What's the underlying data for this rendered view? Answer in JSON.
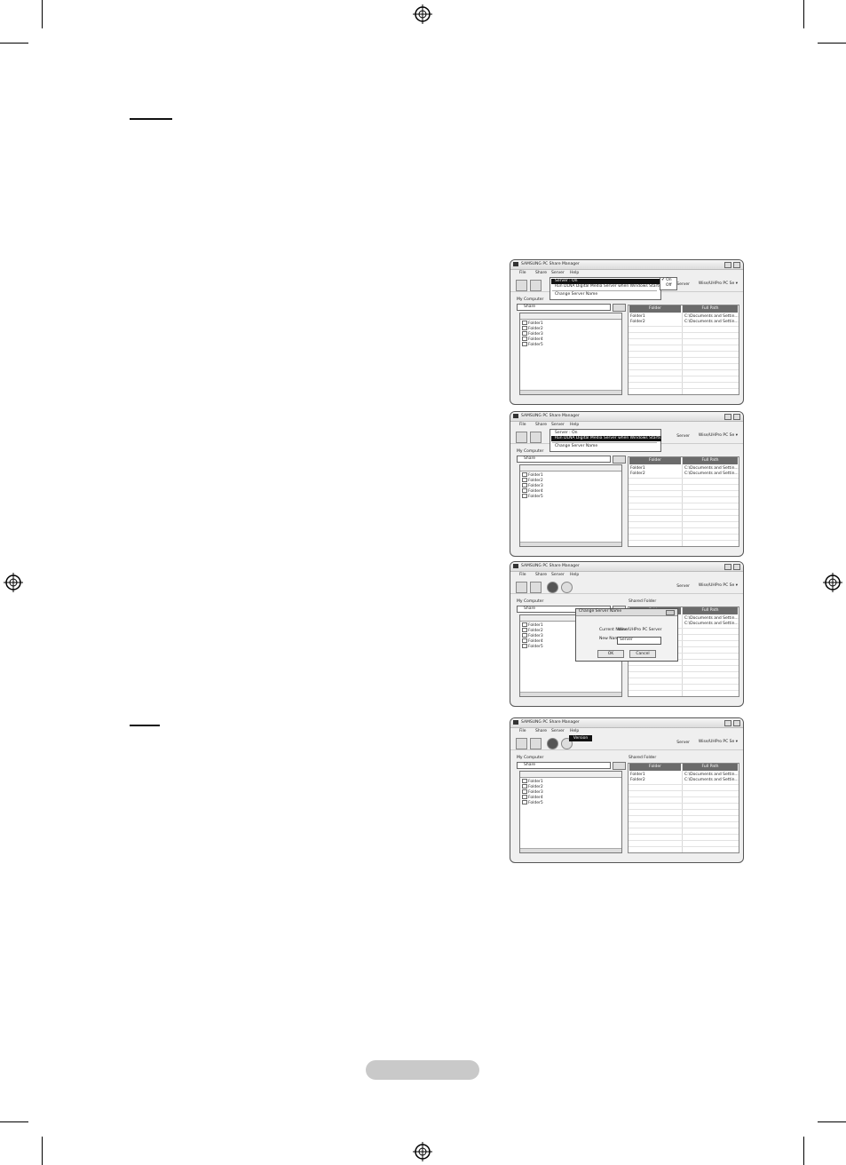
{
  "page": {
    "footer_label": ""
  },
  "screens": [
    {
      "title": "SAMSUNG PC Share Manager",
      "menus": [
        "File",
        "Share",
        "Server",
        "Help"
      ],
      "server_label": "Server",
      "server_value": "Wise/UHPro PC Se",
      "my_computer": "My Computer",
      "share_select": "Share",
      "folders": [
        "Folder1",
        "Folder2",
        "Folder3",
        "Folder4",
        "Folder5"
      ],
      "shared_label": "Shared Folder",
      "col_folder": "Folder",
      "col_path": "Full Path",
      "rows": [
        {
          "folder": "Folder1",
          "path": "C:\\Documents and Settin..."
        },
        {
          "folder": "Folder2",
          "path": "C:\\Documents and Settin..."
        }
      ],
      "dropdown": [
        "Server : On",
        "Run DLNA Digital Media Server when Windows Starts",
        "Change Server Name"
      ],
      "submenu": [
        "On",
        "Off"
      ]
    },
    {
      "title": "SAMSUNG PC Share Manager",
      "menus": [
        "File",
        "Share",
        "Server",
        "Help"
      ],
      "server_label": "Server",
      "server_value": "Wise/UHPro PC Se",
      "my_computer": "My Computer",
      "share_select": "Share",
      "folders": [
        "Folder1",
        "Folder2",
        "Folder3",
        "Folder4",
        "Folder5"
      ],
      "shared_label": "Shared Folder",
      "col_folder": "Folder",
      "col_path": "Full Path",
      "rows": [
        {
          "folder": "Folder1",
          "path": "C:\\Documents and Settin..."
        },
        {
          "folder": "Folder2",
          "path": "C:\\Documents and Settin..."
        }
      ],
      "dropdown": [
        "Server : On",
        "Run DLNA Digital Media Server when Windows Starts",
        "Change Server Name"
      ]
    },
    {
      "title": "SAMSUNG PC Share Manager",
      "menus": [
        "File",
        "Share",
        "Server",
        "Help"
      ],
      "server_label": "Server",
      "server_value": "Wise/UHPro PC Se",
      "my_computer": "My Computer",
      "share_select": "Share",
      "folders": [
        "Folder1",
        "Folder2",
        "Folder3",
        "Folder4",
        "Folder5"
      ],
      "shared_label": "Shared Folder",
      "col_folder": "Folder",
      "col_path": "Full Path",
      "rows": [
        {
          "folder": "Folder1",
          "path": "C:\\Documents and Settin..."
        },
        {
          "folder": "Folder2",
          "path": "C:\\Documents and Settin..."
        }
      ],
      "dialog": {
        "title": "Change Server Name",
        "current_label": "Current Name",
        "current_value": "Wise/UHPro PC Server",
        "new_label": "New Name",
        "new_value": "Server",
        "ok": "OK",
        "cancel": "Cancel"
      }
    },
    {
      "title": "SAMSUNG PC Share Manager",
      "menus": [
        "File",
        "Share",
        "Server",
        "Help"
      ],
      "server_label": "Server",
      "server_value": "Wise/UHPro PC Se",
      "my_computer": "My Computer",
      "share_select": "Share",
      "folders": [
        "Folder1",
        "Folder2",
        "Folder3",
        "Folder4",
        "Folder5"
      ],
      "shared_label": "Shared Folder",
      "col_folder": "Folder",
      "col_path": "Full Path",
      "rows": [
        {
          "folder": "Folder1",
          "path": "C:\\Documents and Settin..."
        },
        {
          "folder": "Folder2",
          "path": "C:\\Documents and Settin..."
        }
      ],
      "tooltip": "Version"
    }
  ]
}
